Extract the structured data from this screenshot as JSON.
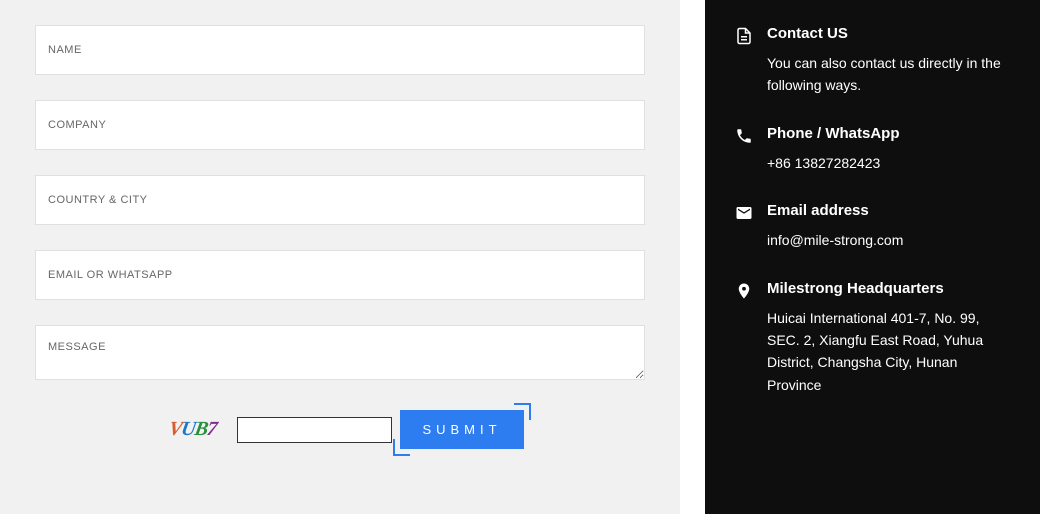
{
  "form": {
    "name_placeholder": "NAME",
    "company_placeholder": "COMPANY",
    "country_placeholder": "COUNTRY & CITY",
    "email_placeholder": "EMAIL OR WHATSAPP",
    "message_placeholder": "MESSAGE",
    "captcha_chars": [
      "V",
      "U",
      "B",
      "7"
    ],
    "submit_label": "SUBMIT"
  },
  "contact": {
    "items": [
      {
        "icon": "document-icon",
        "title": "Contact US",
        "text": "You can also contact us directly in the following ways."
      },
      {
        "icon": "phone-icon",
        "title": "Phone / WhatsApp",
        "text": "+86 13827282423"
      },
      {
        "icon": "email-icon",
        "title": "Email address",
        "text": "info@mile-strong.com"
      },
      {
        "icon": "location-icon",
        "title": "Milestrong Headquarters",
        "text": "Huicai International 401-7, No. 99, SEC. 2, Xiangfu East Road, Yuhua District, Changsha City, Hunan Province"
      }
    ]
  }
}
